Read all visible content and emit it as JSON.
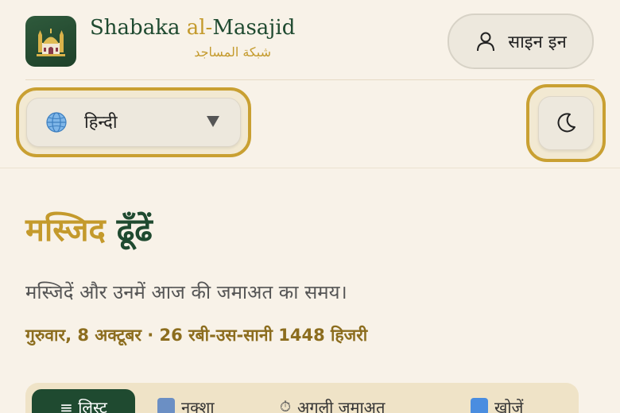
{
  "brand": {
    "name_part1": "Shabaka ",
    "name_accent": "al-",
    "name_part2": "Masajid",
    "name_arabic": "شبكة المساجد"
  },
  "header": {
    "signin_label": "साइन इन"
  },
  "toolbar": {
    "language_label": "हिन्दी"
  },
  "main": {
    "title_part1": "मस्जिद",
    "title_part2": "ढूँढें",
    "subtitle": "मस्जिदें और उनमें आज की जमाअत का समय।",
    "date_line": "गुरुवार, 8 अक्टूबर · 26 रबी-उस-सानी 1448 हिजरी"
  },
  "tabs": [
    {
      "label": "≡ लिस्ट",
      "icon": "list-icon"
    },
    {
      "label": "नक्शा",
      "icon": "map-icon"
    },
    {
      "label": "अगली जमाअत",
      "icon": "clock-icon"
    },
    {
      "label": "खोजें",
      "icon": "search-icon"
    }
  ],
  "colors": {
    "accent_gold": "#c49a2c",
    "brand_green": "#1f4a30",
    "background": "#f8f2e8"
  }
}
